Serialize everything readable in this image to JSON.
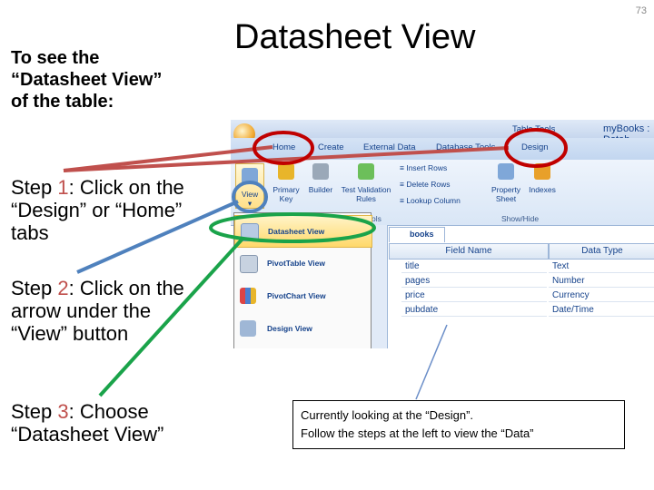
{
  "slide": {
    "title": "Datasheet View",
    "page_number": "73",
    "lead": "To see the “Datasheet View” of the table:",
    "steps": [
      {
        "prefix": "Step ",
        "num": "1",
        "text": ": Click on the “Design” or “Home” tabs"
      },
      {
        "prefix": "Step ",
        "num": "2",
        "text": ": Click on the arrow under the “View” button"
      },
      {
        "prefix": "Step ",
        "num": "3",
        "text": ": Choose “Datasheet View”"
      }
    ],
    "callout": [
      "Currently looking at the “Design”.",
      "Follow the steps at the left to view the “Data”"
    ]
  },
  "app": {
    "window_title": "myBooks : Datab",
    "context_label": "Table Tools",
    "tabs": [
      "Home",
      "Create",
      "External Data",
      "Database Tools",
      "Design"
    ],
    "ribbon": {
      "view": "View",
      "primary_key": "Primary Key",
      "builder": "Builder",
      "test_rules": "Test Validation Rules",
      "insert_rows": "Insert Rows",
      "delete_rows": "Delete Rows",
      "lookup_column": "Lookup Column",
      "property_sheet": "Property Sheet",
      "indexes": "Indexes",
      "group_tools": "Tools",
      "group_showhide": "Show/Hide"
    },
    "view_menu": [
      "Datasheet View",
      "PivotTable View",
      "PivotChart View",
      "Design View"
    ],
    "doc_tab": "books",
    "grid": {
      "headers": [
        "Field Name",
        "Data Type"
      ],
      "rows": [
        [
          "title",
          "Text"
        ],
        [
          "pages",
          "Number"
        ],
        [
          "price",
          "Currency"
        ],
        [
          "pubdate",
          "Date/Time"
        ]
      ]
    }
  },
  "colors": {
    "step_number": "#c0504d",
    "ring_red": "#c00000",
    "ring_blue": "#4f81bd",
    "ring_green": "#1aa34a"
  }
}
